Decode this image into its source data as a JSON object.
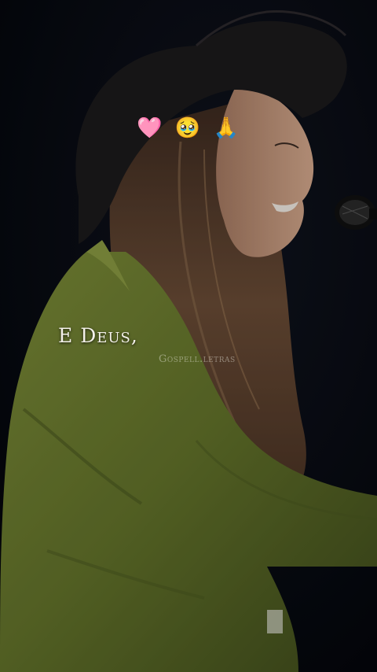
{
  "reel": {
    "emojis": [
      "🩷",
      "🥹",
      "🙏"
    ],
    "lyric_text": "E Deus,",
    "watermark": "Gospell.letras"
  },
  "colors": {
    "background": "#05070d",
    "jacket": "#6f7f2e",
    "hat": "#1c1a1c",
    "hair": "#5a4030",
    "skin": "#c89a7e",
    "lyric_text": "#f4f1ea"
  },
  "icons": {
    "emoji_1": "pink-heart-icon",
    "emoji_2": "face-holding-back-tears-icon",
    "emoji_3": "folded-hands-icon",
    "microphone": "microphone-icon"
  }
}
